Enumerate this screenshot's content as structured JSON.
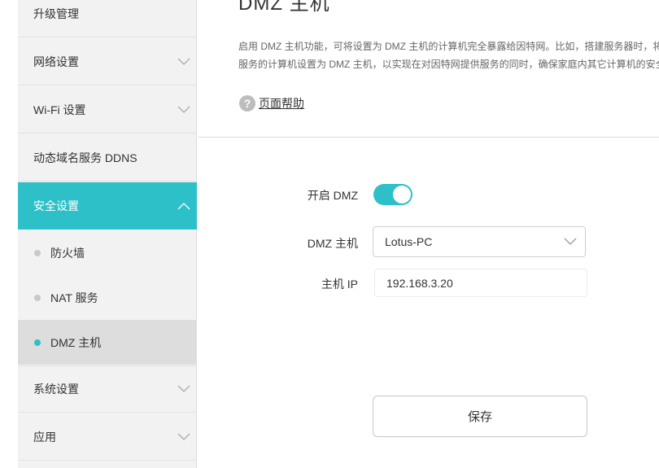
{
  "sidebar": {
    "items": [
      {
        "label": "升级管理"
      },
      {
        "label": "网络设置"
      },
      {
        "label": "Wi-Fi 设置"
      },
      {
        "label": "动态域名服务 DDNS"
      },
      {
        "label": "安全设置"
      },
      {
        "label": "系统设置"
      },
      {
        "label": "应用"
      }
    ],
    "security_sub": [
      {
        "label": "防火墙"
      },
      {
        "label": "NAT 服务"
      },
      {
        "label": "DMZ 主机"
      }
    ]
  },
  "main": {
    "title": "DMZ 主机",
    "description_line1": "启用 DMZ 主机功能，可将设置为 DMZ 主机的计算机完全暴露给因特网。比如，搭建服务器时，将",
    "description_line2": "服务的计算机设置为 DMZ 主机，以实现在对因特网提供服务的同时，确保家庭内其它计算机的安全",
    "help_icon": "?",
    "help_label": "页面帮助"
  },
  "form": {
    "enable_label": "开启 DMZ",
    "enable_value": true,
    "host_label": "DMZ 主机",
    "host_value": "Lotus-PC",
    "ip_label": "主机 IP",
    "ip_value": "192.168.3.20",
    "save_label": "保存"
  },
  "colors": {
    "accent": "#2ec0c8",
    "sidebar_bg": "#f2f2f2",
    "selected_bg": "#dddddd"
  }
}
